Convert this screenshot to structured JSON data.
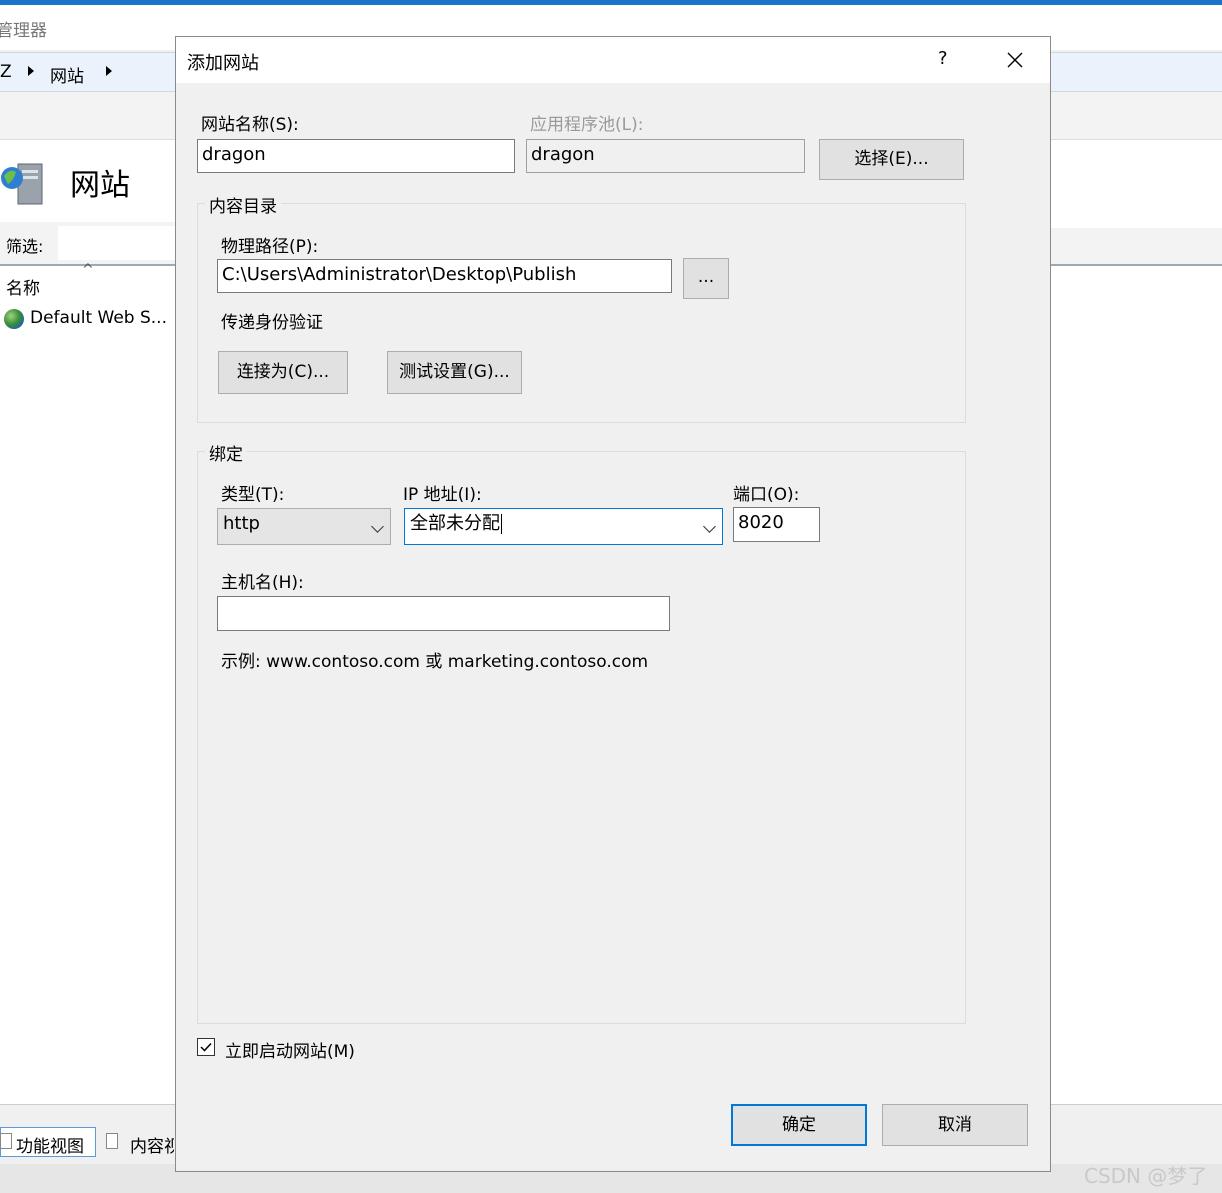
{
  "background": {
    "window_title_partial": "管理器",
    "breadcrumb": [
      "Z",
      "网站"
    ],
    "page_title": "网站",
    "filter_label": "筛选:",
    "column_name": "名称",
    "sites": [
      "Default Web S..."
    ],
    "bottom_tabs": [
      "功能视图",
      "内容视图"
    ],
    "watermark": "CSDN @梦了"
  },
  "dialog": {
    "title": "添加网站",
    "help_glyph": "?",
    "site_name_label": "网站名称(S):",
    "site_name_value": "dragon",
    "app_pool_label": "应用程序池(L):",
    "app_pool_value": "dragon",
    "select_button": "选择(E)...",
    "content_group_title": "内容目录",
    "physical_path_label": "物理路径(P):",
    "physical_path_value": "C:\\Users\\Administrator\\Desktop\\Publish",
    "browse_button": "...",
    "pass_auth_label": "传递身份验证",
    "connect_as_button": "连接为(C)...",
    "test_settings_button": "测试设置(G)...",
    "binding_group_title": "绑定",
    "type_label": "类型(T):",
    "type_value": "http",
    "ip_label": "IP 地址(I):",
    "ip_value": "全部未分配",
    "port_label": "端口(O):",
    "port_value": "8020",
    "host_label": "主机名(H):",
    "host_value": "",
    "example_text": "示例: www.contoso.com 或 marketing.contoso.com",
    "start_checkbox_label": "立即启动网站(M)",
    "start_checked": true,
    "ok_button": "确定",
    "cancel_button": "取消"
  }
}
